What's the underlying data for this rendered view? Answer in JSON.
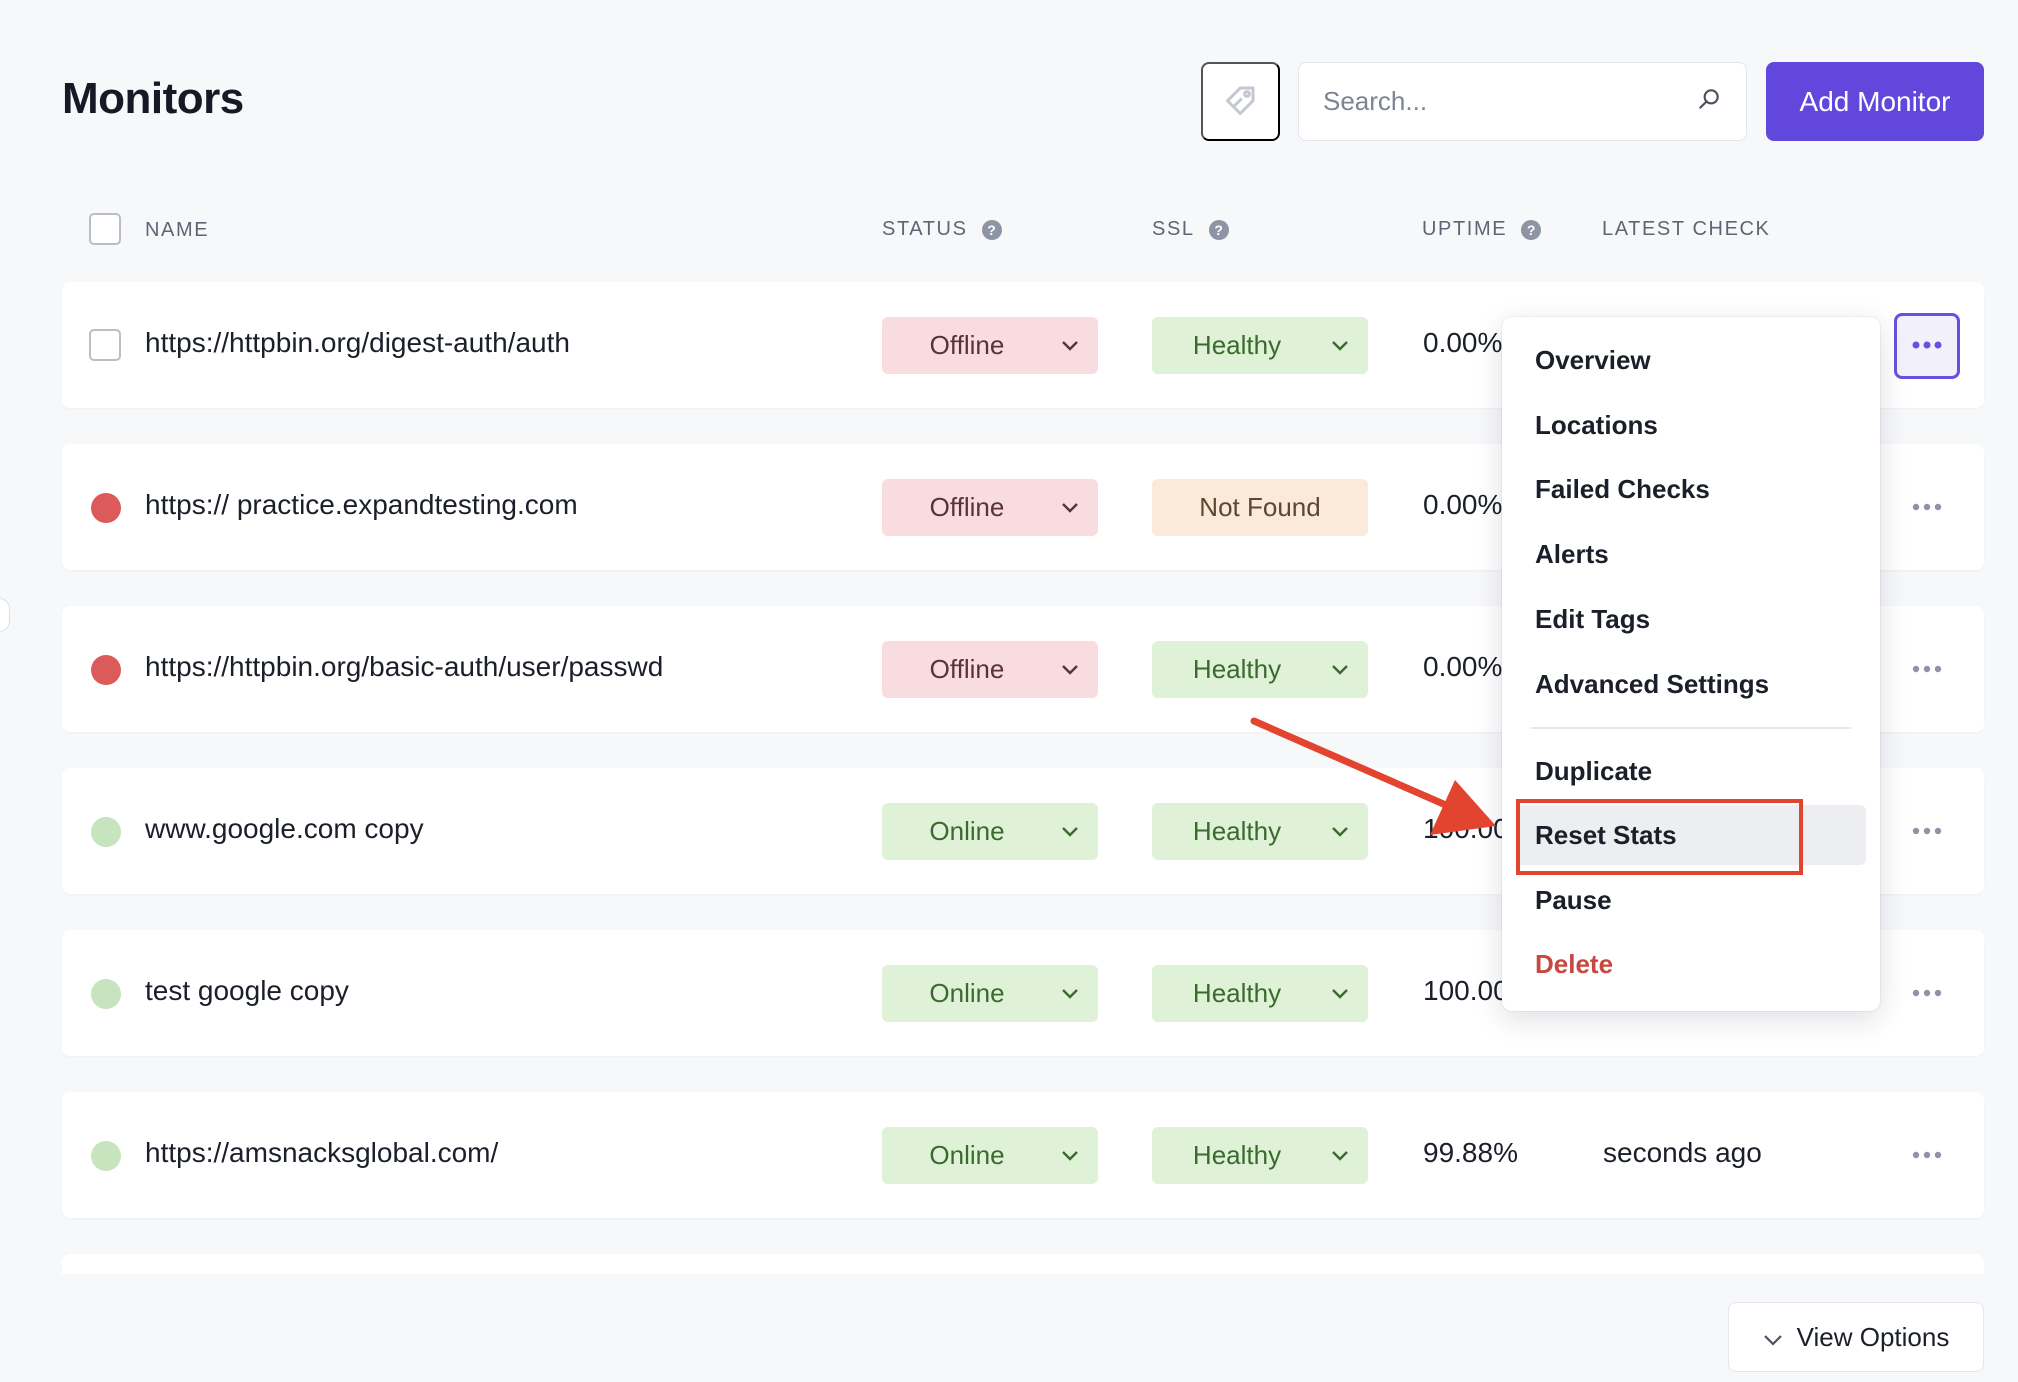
{
  "page": {
    "title": "Monitors"
  },
  "toolbar": {
    "tag_icon": "tag-icon",
    "search_placeholder": "Search...",
    "search_value": "",
    "search_icon": "search-icon",
    "add_label": "Add Monitor"
  },
  "table": {
    "headers": {
      "name": "NAME",
      "status": "STATUS",
      "ssl": "SSL",
      "uptime": "UPTIME",
      "latest": "LATEST CHECK"
    },
    "rows": [
      {
        "lead": "checkbox",
        "name": "https://httpbin.org/digest-auth/auth",
        "status": "Offline",
        "ssl": "Healthy",
        "uptime": "0.00%",
        "latest": ""
      },
      {
        "lead": "red-dot",
        "name": "https:// practice.expandtesting.com",
        "status": "Offline",
        "ssl": "Not Found",
        "uptime": "0.00%",
        "latest": ""
      },
      {
        "lead": "red-dot",
        "name": "https://httpbin.org/basic-auth/user/passwd",
        "status": "Offline",
        "ssl": "Healthy",
        "uptime": "0.00%",
        "latest": ""
      },
      {
        "lead": "green-dot",
        "name": "www.google.com copy",
        "status": "Online",
        "ssl": "Healthy",
        "uptime": "100.00%",
        "latest": ""
      },
      {
        "lead": "green-dot",
        "name": "test google copy",
        "status": "Online",
        "ssl": "Healthy",
        "uptime": "100.00%",
        "latest": ""
      },
      {
        "lead": "green-dot",
        "name": "https://amsnacksglobal.com/",
        "status": "Online",
        "ssl": "Healthy",
        "uptime": "99.88%",
        "latest": "seconds ago"
      }
    ]
  },
  "menu": {
    "items": [
      "Overview",
      "Locations",
      "Failed Checks",
      "Alerts",
      "Edit Tags",
      "Advanced Settings",
      "Duplicate",
      "Reset Stats",
      "Pause",
      "Delete"
    ],
    "highlighted": "Reset Stats"
  },
  "footer": {
    "view_options": "View Options"
  },
  "colors": {
    "accent": "#6247dc",
    "offline_bg": "#f8dcdf",
    "online_bg": "#dff2d8",
    "notfound_bg": "#fbe9da",
    "danger": "#c8473f",
    "annotation": "#e2442f"
  }
}
